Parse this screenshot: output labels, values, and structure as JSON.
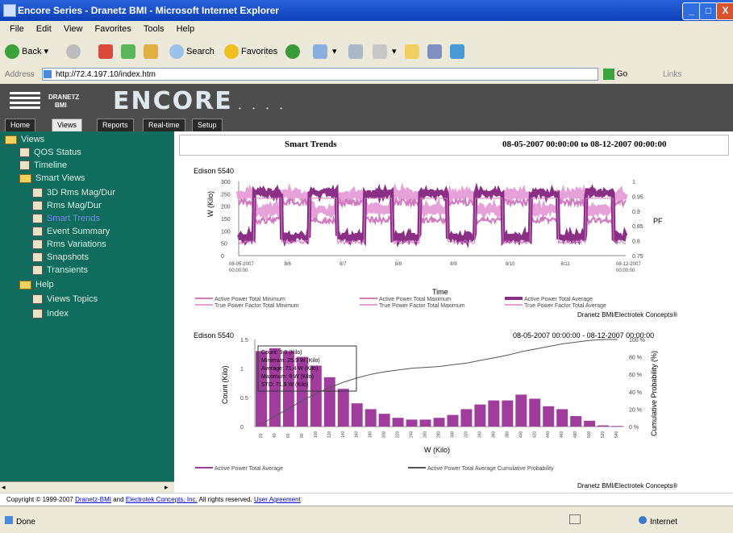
{
  "window": {
    "title": "Encore Series - Dranetz BMI - Microsoft Internet Explorer",
    "controls": [
      "_",
      "□",
      "X"
    ]
  },
  "menu": [
    "File",
    "Edit",
    "View",
    "Favorites",
    "Tools",
    "Help"
  ],
  "toolbar": {
    "back": "Back",
    "search": "Search",
    "favorites": "Favorites"
  },
  "address": {
    "label": "Address",
    "url": "http://72.4.197.10/index.htm",
    "go": "Go",
    "links": "Links"
  },
  "app": {
    "logo_line1": "DRANETZ",
    "logo_line2": "BMI",
    "product": "ENCORE",
    "tabs": [
      "Home",
      "Views",
      "Reports",
      "Real-time",
      "Setup"
    ],
    "active_tab": "Views"
  },
  "sidebar": {
    "items": [
      {
        "label": "Views",
        "type": "folder"
      },
      {
        "label": "QOS Status",
        "type": "page"
      },
      {
        "label": "Timeline",
        "type": "page"
      },
      {
        "label": "Smart Views",
        "type": "folder"
      },
      {
        "label": "3D Rms Mag/Dur",
        "type": "page"
      },
      {
        "label": "Rms Mag/Dur",
        "type": "page"
      },
      {
        "label": "Smart Trends",
        "type": "page",
        "selected": true
      },
      {
        "label": "Event Summary",
        "type": "page"
      },
      {
        "label": "Rms Variations",
        "type": "page"
      },
      {
        "label": "Snapshots",
        "type": "page"
      },
      {
        "label": "Transients",
        "type": "page"
      },
      {
        "label": "Help",
        "type": "folder"
      },
      {
        "label": "Views Topics",
        "type": "page"
      },
      {
        "label": "Index",
        "type": "page"
      }
    ]
  },
  "content": {
    "title": "Smart Trends",
    "range": "08-05-2007 00:00:00 to 08-12-2007 00:00:00"
  },
  "chart_data": [
    {
      "type": "line",
      "title": "Edison 5540",
      "xlabel": "Time",
      "ylabel": "W (Kilo)",
      "y2label": "PF",
      "ylim": [
        0,
        300
      ],
      "y2lim": [
        0.75,
        1
      ],
      "yticks": [
        "300",
        "250",
        "200",
        "150",
        "100",
        "50",
        "0"
      ],
      "y2ticks": [
        "1",
        "0.95",
        "0.9",
        "0.85",
        "0.8",
        "0.75"
      ],
      "xticks": [
        "08-05-2007\n00:00:00",
        "8/6",
        "8/7",
        "8/8",
        "8/9",
        "8/10",
        "8/11",
        "08-12-2007\n00:00:00"
      ],
      "series": [
        {
          "name": "Active Power Total Minimum"
        },
        {
          "name": "True Power Factor Total Minimum"
        },
        {
          "name": "Active Power Total Maximum"
        },
        {
          "name": "True Power Factor Total Maximum"
        },
        {
          "name": "Active Power Total Average"
        },
        {
          "name": "True Power Factor Total Average"
        }
      ],
      "credit": "Dranetz BMI/Electrotek Concepts®",
      "grid": false
    },
    {
      "type": "bar",
      "title": "Edison 5540",
      "range": "08-05-2007 00:00:00 - 08-12-2007 00:00:00",
      "xlabel": "W (Kilo)",
      "ylabel": "Count (Kilo)",
      "y2label": "Cumulative Probability (%)",
      "ylim": [
        0,
        1.5
      ],
      "yticks": [
        "1.5",
        "1",
        "0.5",
        "0"
      ],
      "y2ticks": [
        "100 %",
        "80 %",
        "60 %",
        "40 %",
        "20 %",
        "0 %"
      ],
      "categories": [
        "20",
        "40",
        "60",
        "80",
        "100",
        "120",
        "140",
        "160",
        "180",
        "200",
        "220",
        "240",
        "260",
        "280",
        "300",
        "320",
        "340",
        "360",
        "380",
        "400",
        "420",
        "440",
        "460",
        "480",
        "500",
        "520",
        "540"
      ],
      "values": [
        1.3,
        1.35,
        1.3,
        1.2,
        1.05,
        0.85,
        0.65,
        0.4,
        0.3,
        0.22,
        0.15,
        0.12,
        0.12,
        0.15,
        0.2,
        0.3,
        0.38,
        0.45,
        0.45,
        0.55,
        0.48,
        0.35,
        0.3,
        0.18,
        0.1,
        0.02,
        0.01
      ],
      "cumulative": [
        3,
        12,
        21,
        30,
        38,
        45,
        51,
        56,
        60,
        63,
        65,
        67,
        68,
        69,
        71,
        73,
        76,
        79,
        82,
        86,
        89,
        92,
        95,
        97,
        99,
        100,
        100
      ],
      "series": [
        {
          "name": "Active Power Total Average"
        },
        {
          "name": "Active Power Total Average Cumulative Probability"
        }
      ],
      "stats_box": [
        "Count: 9.9 (Kilo)",
        "Minimum: 25.9 W (Kilo)",
        "Average: 71.4 W (Kilo)",
        "Maximum: 9 W (Kilo)",
        "STD: 71.9 W (Kilo)"
      ],
      "credit": "Dranetz BMI/Electrotek Concepts®"
    }
  ],
  "footer": {
    "copyright_prefix": "Copyright © 1999-2007",
    "link1": "Dranetz-BMI",
    "and": "and",
    "link2": "Electrotek Concepts, Inc.",
    "rights": "All rights reserved.",
    "link3": "User Agreement"
  },
  "status": {
    "left": "Done",
    "zone": "Internet"
  },
  "colors": {
    "sidebar": "#106d5d",
    "header": "#4d4d4d",
    "series_light": "#e6a2d8",
    "series_mid": "#d07ac0",
    "series_dark": "#8a2e86",
    "bar": "#a03d9c"
  }
}
